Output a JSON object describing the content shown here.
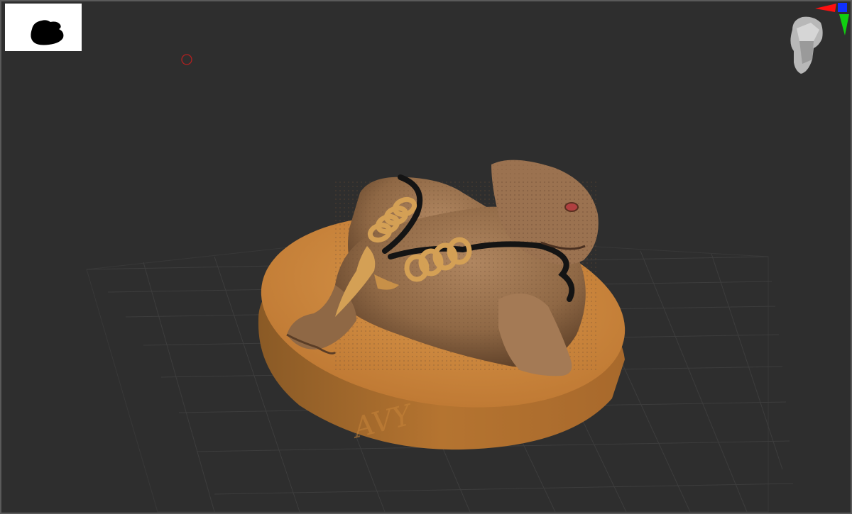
{
  "viewport": {
    "background": "#2e2e2e",
    "border_color": "#5a5a5a"
  },
  "thumbnail": {
    "icon": "model-silhouette-icon",
    "background": "#ffffff"
  },
  "cursor": {
    "icon": "brush-cursor-ring-icon",
    "color": "#b42020"
  },
  "model": {
    "subject": "toad-on-coin-pedestal",
    "body_color": "#8f6845",
    "base_color": "#c8853a",
    "coin_color": "#d4a055",
    "cord_color": "#141414",
    "eye_color": "#b04040",
    "watermark": "AVY"
  },
  "navigator": {
    "icon": "head-orientation-gizmo-icon",
    "axis_colors": {
      "x": "#ff1010",
      "y": "#10d010",
      "z": "#1030ff"
    }
  }
}
